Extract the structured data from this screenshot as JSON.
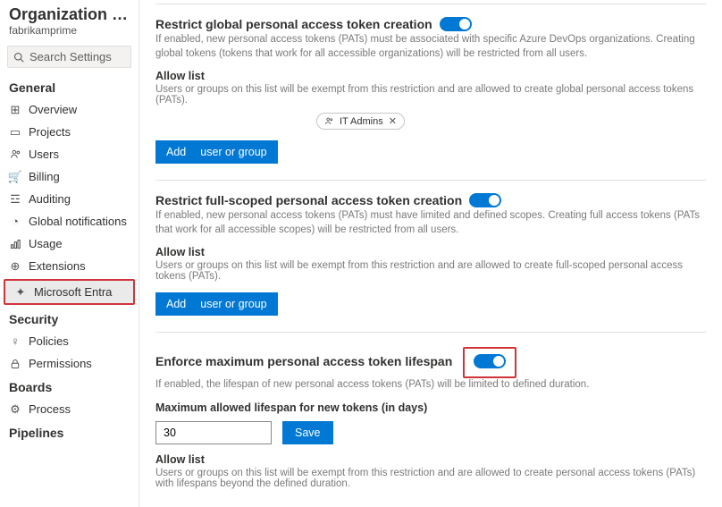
{
  "sidebar": {
    "title": "Organization S…",
    "subtitle": "fabrikamprime",
    "search_placeholder": "Search Settings",
    "groups": [
      {
        "label": "General",
        "items": [
          {
            "icon": "grid-icon",
            "label": "Overview"
          },
          {
            "icon": "projects-icon",
            "label": "Projects"
          },
          {
            "icon": "users-icon",
            "label": "Users"
          },
          {
            "icon": "billing-icon",
            "label": "Billing"
          },
          {
            "icon": "auditing-icon",
            "label": "Auditing"
          },
          {
            "icon": "bell-icon",
            "label": "Global notifications"
          },
          {
            "icon": "usage-icon",
            "label": "Usage"
          },
          {
            "icon": "extensions-icon",
            "label": "Extensions"
          },
          {
            "icon": "entra-icon",
            "label": "Microsoft Entra",
            "active": true
          }
        ]
      },
      {
        "label": "Security",
        "items": [
          {
            "icon": "policies-icon",
            "label": "Policies"
          },
          {
            "icon": "permissions-icon",
            "label": "Permissions"
          }
        ]
      },
      {
        "label": "Boards",
        "items": [
          {
            "icon": "process-icon",
            "label": "Process"
          }
        ]
      },
      {
        "label": "Pipelines",
        "items": []
      }
    ]
  },
  "sections": {
    "global": {
      "title": "Restrict global personal access token creation",
      "desc": "If enabled, new personal access tokens (PATs) must be associated with specific Azure DevOps organizations. Creating global tokens (tokens that work for all accessible organizations) will be restricted from all users.",
      "allow_title": "Allow list",
      "allow_desc": "Users or groups on this list will be exempt from this restriction and are allowed to create global personal access tokens (PATs).",
      "chip": "IT Admins",
      "btn_add": "Add",
      "btn_rest": "user or group"
    },
    "scoped": {
      "title": "Restrict full-scoped personal access token creation",
      "desc": "If enabled, new personal access tokens (PATs) must have limited and defined scopes. Creating full access tokens (PATs that work for all accessible scopes) will be restricted from all users.",
      "allow_title": "Allow list",
      "allow_desc": "Users or groups on this list will be exempt from this restriction and are allowed to create full-scoped personal access tokens (PATs).",
      "btn_add": "Add",
      "btn_rest": "user or group"
    },
    "lifespan": {
      "title": "Enforce maximum personal access token lifespan",
      "desc": "If enabled, the lifespan of new personal access tokens (PATs) will be limited to defined duration.",
      "field_label": "Maximum allowed lifespan for new tokens (in days)",
      "value": "30",
      "save": "Save",
      "allow_title": "Allow list",
      "allow_desc": "Users or groups on this list will be exempt from this restriction and are allowed to create personal access tokens (PATs) with lifespans beyond the defined duration."
    }
  }
}
